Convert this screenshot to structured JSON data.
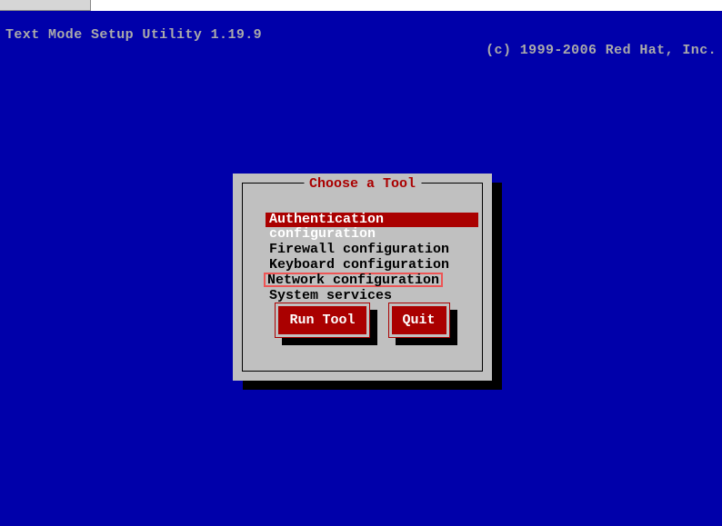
{
  "header": {
    "left": "Text Mode Setup Utility 1.19.9",
    "right": "(c) 1999-2006 Red Hat, Inc."
  },
  "dialog": {
    "title": "Choose a Tool",
    "menu": [
      {
        "label": "Authentication configuration",
        "selected": true,
        "highlighted": false
      },
      {
        "label": "Firewall configuration",
        "selected": false,
        "highlighted": false
      },
      {
        "label": "Keyboard configuration",
        "selected": false,
        "highlighted": false
      },
      {
        "label": "Network configuration",
        "selected": false,
        "highlighted": true
      },
      {
        "label": "System services",
        "selected": false,
        "highlighted": false
      }
    ],
    "buttons": {
      "run": "Run Tool",
      "quit": "Quit"
    }
  }
}
